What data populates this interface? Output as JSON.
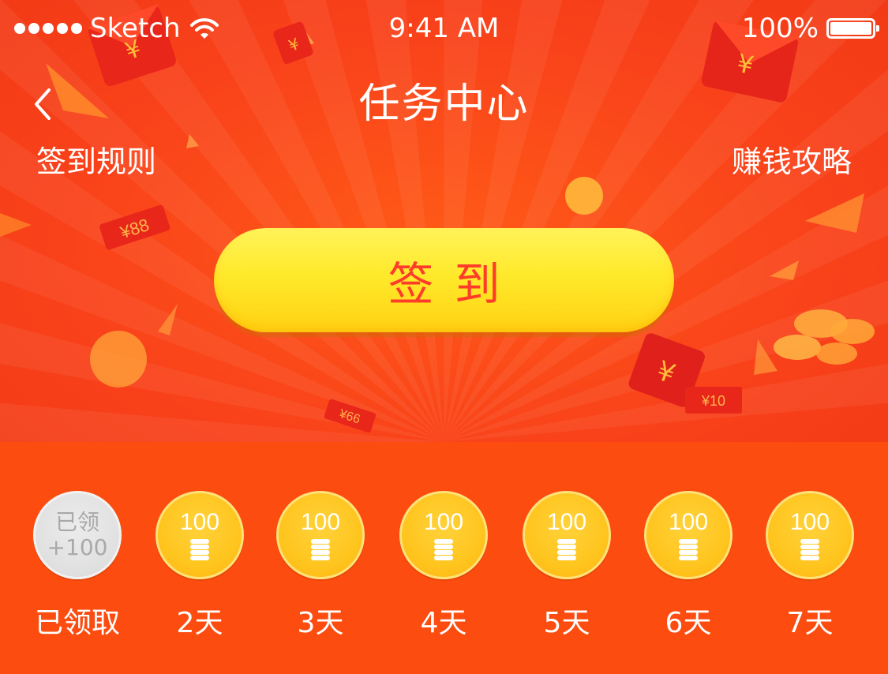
{
  "status_bar": {
    "carrier": "Sketch",
    "time": "9:41 AM",
    "battery": "100%"
  },
  "nav": {
    "title": "任务中心",
    "back_icon": "chevron-left-icon"
  },
  "links": {
    "rules": "签到规则",
    "guide": "赚钱攻略"
  },
  "signin_button": {
    "label": "签到"
  },
  "decorations": {
    "envelope_88": "¥88",
    "envelope_66": "¥66",
    "envelope_10": "¥10"
  },
  "rewards": [
    {
      "status": "claimed",
      "coin_line1": "已领",
      "coin_line2": "+100",
      "label": "已领取"
    },
    {
      "status": "pending",
      "amount": "100",
      "label": "2天"
    },
    {
      "status": "pending",
      "amount": "100",
      "label": "3天"
    },
    {
      "status": "pending",
      "amount": "100",
      "label": "4天"
    },
    {
      "status": "pending",
      "amount": "100",
      "label": "5天"
    },
    {
      "status": "pending",
      "amount": "100",
      "label": "6天"
    },
    {
      "status": "pending",
      "amount": "100",
      "label": "7天"
    }
  ],
  "colors": {
    "background": "#fc4c0f",
    "button_yellow": "#ffe92b",
    "button_text": "#ff3b2a",
    "coin_gold": "#ffc51f",
    "coin_claimed": "#e0e0e0"
  }
}
